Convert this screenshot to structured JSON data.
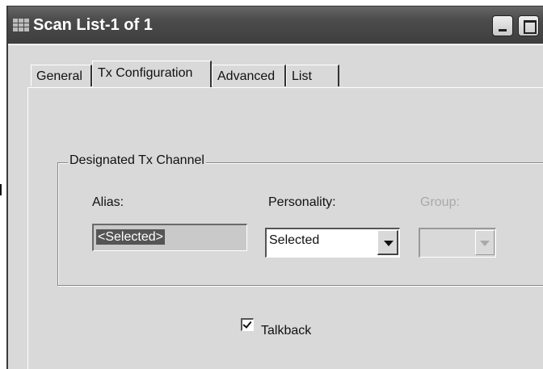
{
  "window": {
    "title": "Scan List-1 of 1",
    "app_icon": "grid-icon",
    "controls": [
      "minimize-icon",
      "maximize-icon"
    ]
  },
  "tabs": [
    {
      "label": "General",
      "active": false
    },
    {
      "label": "Tx Configuration",
      "active": true
    },
    {
      "label": "Advanced",
      "active": false
    },
    {
      "label": "List",
      "active": false
    }
  ],
  "designated_tx_channel": {
    "group_title": "Designated Tx Channel",
    "alias_label": "Alias:",
    "alias_value": "<Selected>",
    "personality_label": "Personality:",
    "personality_value": "Selected",
    "group_label": "Group:",
    "group_value": "",
    "group_enabled": false
  },
  "talkback": {
    "label": "Talkback",
    "checked": true
  }
}
